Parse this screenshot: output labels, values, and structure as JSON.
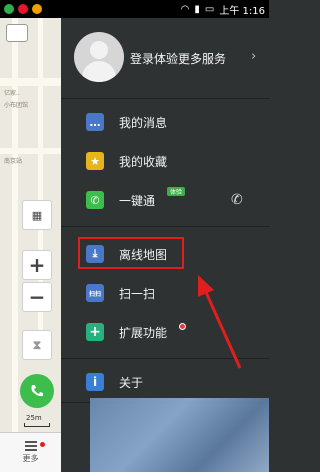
{
  "status_bar": {
    "time": "上午 1:16",
    "icons": [
      "wechat-icon",
      "weibo-icon",
      "alarm-icon",
      "wifi-icon",
      "signal-icon",
      "battery-icon"
    ]
  },
  "map": {
    "labels": [
      "亿家..",
      "小布团馆",
      "南京站"
    ],
    "scale_label": "25m",
    "more_label": "更多",
    "controls": [
      "layers-icon",
      "zoom-in-icon",
      "zoom-out-icon",
      "compass-icon"
    ]
  },
  "drawer": {
    "login_text": "登录体验更多服务",
    "items": [
      {
        "label": "我的消息",
        "icon": "message-icon",
        "color": "#4a78c8"
      },
      {
        "label": "我的收藏",
        "icon": "star-icon",
        "color": "#e6b51c"
      },
      {
        "label": "一键通",
        "icon": "phone-icon",
        "color": "#3cbd4c",
        "badge": "体验"
      },
      {
        "label": "离线地图",
        "icon": "offline-map-icon",
        "color": "#4a78c8"
      },
      {
        "label": "扫一扫",
        "icon": "scan-icon",
        "color": "#4a78c8",
        "icon_text": "扫扫"
      },
      {
        "label": "扩展功能",
        "icon": "plus-icon",
        "color": "#27b17f"
      },
      {
        "label": "关于",
        "icon": "info-icon",
        "color": "#3a7fd6"
      }
    ]
  },
  "colors": {
    "drawer_bg": "#2f3232",
    "highlight": "#e01e1e"
  }
}
